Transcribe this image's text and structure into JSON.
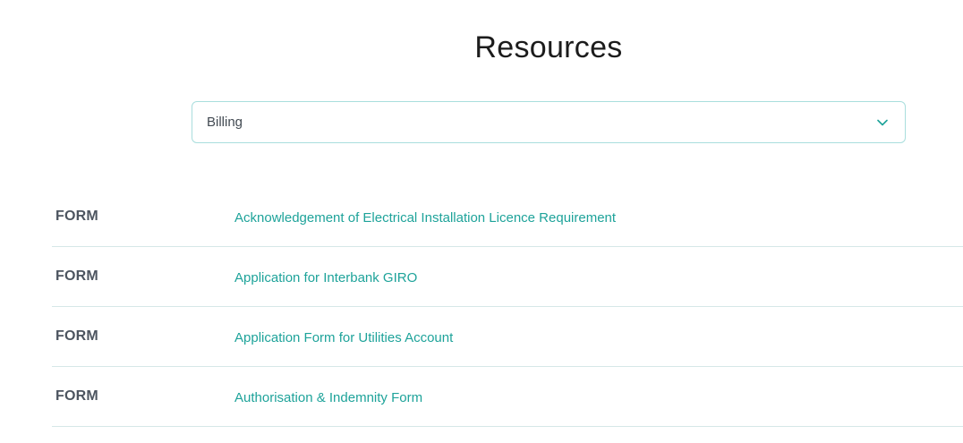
{
  "page": {
    "title": "Resources"
  },
  "filter": {
    "selected": "Billing",
    "icon": "chevron-down-icon"
  },
  "resources": [
    {
      "type": "FORM",
      "title": "Acknowledgement of Electrical Installation Licence Requirement"
    },
    {
      "type": "FORM",
      "title": "Application for Interbank GIRO"
    },
    {
      "type": "FORM",
      "title": "Application Form for Utilities Account"
    },
    {
      "type": "FORM",
      "title": "Authorisation & Indemnity Form"
    }
  ],
  "colors": {
    "accent": "#1ea39a",
    "border": "#a9dedd",
    "divider": "#d6e8e8",
    "type_text": "#4d5560",
    "title_text": "#1c1c1c"
  }
}
